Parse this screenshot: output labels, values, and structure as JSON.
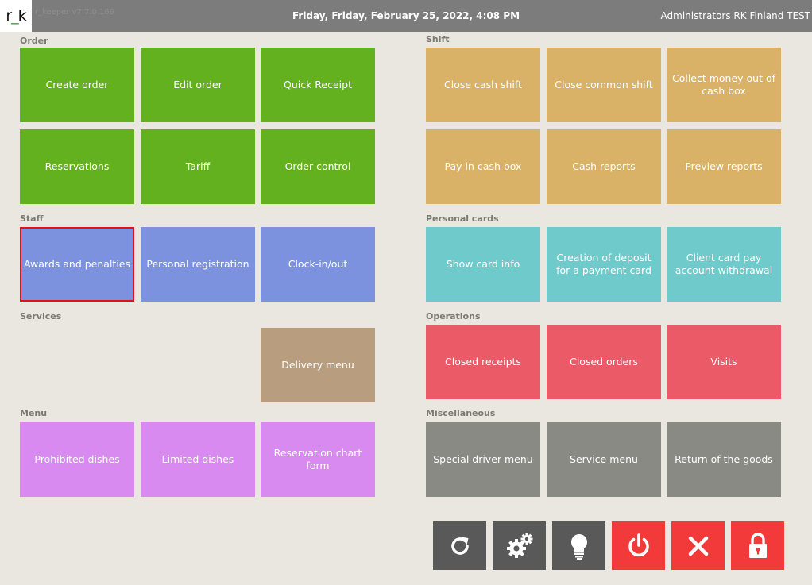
{
  "header": {
    "logo": {
      "left": "r",
      "sep": "_",
      "right": "k"
    },
    "version": "r_keeper v7.7.0.169",
    "datetime": "Friday, Friday, February 25, 2022, 4:08 PM",
    "user": "Administrators RK Finland TEST"
  },
  "sections": {
    "order": "Order",
    "shift": "Shift",
    "staff": "Staff",
    "personal_cards": "Personal cards",
    "services": "Services",
    "operations": "Operations",
    "menu": "Menu",
    "miscellaneous": "Miscellaneous"
  },
  "order": {
    "create_order": "Create order",
    "edit_order": "Edit order",
    "quick_receipt": "Quick Receipt",
    "reservations": "Reservations",
    "tariff": "Tariff",
    "order_control": "Order control"
  },
  "shift": {
    "close_cash_shift": "Close cash shift",
    "close_common_shift": "Close common shift",
    "collect_money": "Collect money out of cash box",
    "pay_in_cash_box": "Pay in cash box",
    "cash_reports": "Cash reports",
    "preview_reports": "Preview reports"
  },
  "staff": {
    "awards_and_penalties": "Awards and penalties",
    "personal_registration": "Personal registration",
    "clock_in_out": "Clock-in/out"
  },
  "personal_cards": {
    "show_card_info": "Show card info",
    "creation_of_deposit": "Creation of deposit for a payment card",
    "client_card_withdrawal": "Client card pay account withdrawal"
  },
  "services": {
    "delivery_menu": "Delivery menu"
  },
  "operations": {
    "closed_receipts": "Closed receipts",
    "closed_orders": "Closed orders",
    "visits": "Visits"
  },
  "menu": {
    "prohibited_dishes": "Prohibited dishes",
    "limited_dishes": "Limited dishes",
    "reservation_chart_form": "Reservation chart form"
  },
  "miscellaneous": {
    "special_driver_menu": "Special driver menu",
    "service_menu": "Service menu",
    "return_of_goods": "Return of the goods"
  },
  "toolbar": {
    "icons": [
      "refresh-icon",
      "gears-icon",
      "lightbulb-icon",
      "power-icon",
      "close-icon",
      "lock-icon"
    ],
    "colors": {
      "dark": "#595959",
      "alert": "#f23a3a"
    }
  },
  "colors": {
    "order": "#64b11f",
    "shift": "#d9b267",
    "staff": "#7c92df",
    "personal_cards": "#6fcbcb",
    "operations": "#ea5a67",
    "services": "#b89d7f",
    "menu": "#d98af0",
    "miscellaneous": "#8a8a84",
    "selected_border": "#e2101b"
  },
  "selected_tile": "Awards and penalties"
}
